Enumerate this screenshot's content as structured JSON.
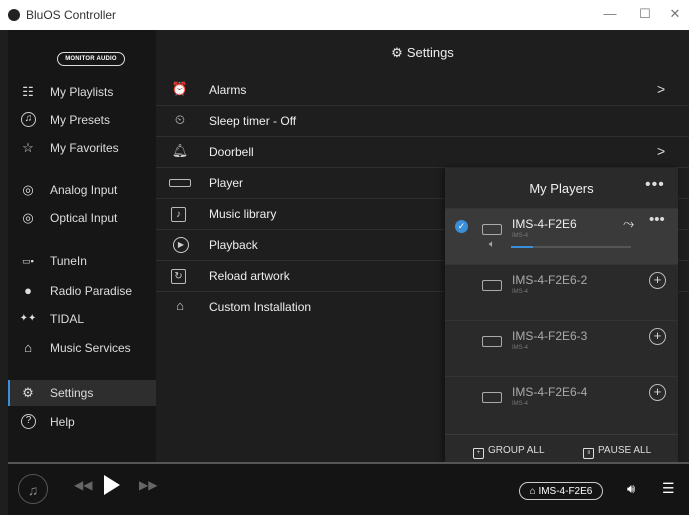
{
  "window": {
    "title": "BluOS Controller",
    "min": "—",
    "max": "☐",
    "close": "✕"
  },
  "sidebar": {
    "logo": "MONITOR AUDIO",
    "items": [
      {
        "label": "My Playlists",
        "icon": "playlist-icon"
      },
      {
        "label": "My Presets",
        "icon": "presets-icon"
      },
      {
        "label": "My Favorites",
        "icon": "star-icon"
      },
      {
        "label": "Analog Input",
        "icon": "analog-input-icon"
      },
      {
        "label": "Optical Input",
        "icon": "optical-input-icon"
      },
      {
        "label": "TuneIn",
        "icon": "tunein-icon"
      },
      {
        "label": "Radio Paradise",
        "icon": "radio-paradise-icon"
      },
      {
        "label": "TIDAL",
        "icon": "tidal-icon"
      },
      {
        "label": "Music Services",
        "icon": "music-services-icon"
      },
      {
        "label": "Settings",
        "icon": "gear-icon",
        "active": true
      },
      {
        "label": "Help",
        "icon": "help-icon"
      }
    ]
  },
  "main": {
    "title": "Settings",
    "rows": [
      {
        "label": "Alarms",
        "icon": "alarm-icon",
        "chevron": ">"
      },
      {
        "label": "Sleep timer - Off",
        "icon": "sleep-timer-icon"
      },
      {
        "label": "Doorbell",
        "icon": "bell-icon",
        "chevron": ">"
      },
      {
        "label": "Player",
        "icon": "player-device-icon"
      },
      {
        "label": "Music library",
        "icon": "music-library-icon"
      },
      {
        "label": "Playback",
        "icon": "playback-icon"
      },
      {
        "label": "Reload artwork",
        "icon": "reload-icon"
      },
      {
        "label": "Custom Installation",
        "icon": "custom-install-icon"
      }
    ]
  },
  "players_panel": {
    "title": "My Players",
    "more": "•••",
    "players": [
      {
        "name": "IMS-4-F2E6",
        "model": "IMS-4",
        "selected": true,
        "volume": 0.18
      },
      {
        "name": "IMS-4-F2E6-2",
        "model": "IMS-4",
        "selected": false
      },
      {
        "name": "IMS-4-F2E6-3",
        "model": "IMS-4",
        "selected": false
      },
      {
        "name": "IMS-4-F2E6-4",
        "model": "IMS-4",
        "selected": false
      }
    ],
    "group_all": "GROUP ALL",
    "pause_all": "PAUSE ALL"
  },
  "bottom": {
    "current_player": "IMS-4-F2E6",
    "accent": "#3a8fd8"
  }
}
